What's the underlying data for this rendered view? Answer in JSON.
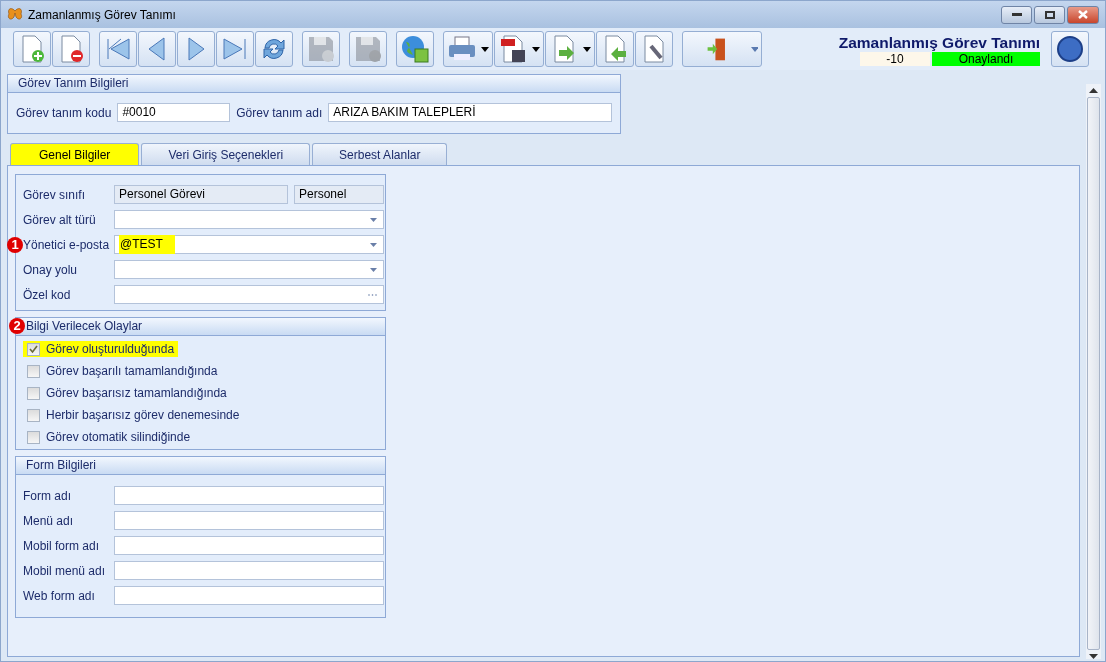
{
  "window": {
    "title": "Zamanlanmış Görev Tanımı"
  },
  "toolbar": [
    [
      {
        "kind": "new",
        "disabled": false,
        "dropdown": false
      },
      {
        "kind": "delete",
        "disabled": false,
        "dropdown": false
      }
    ],
    [
      {
        "kind": "first",
        "disabled": false,
        "dropdown": false
      },
      {
        "kind": "prev",
        "disabled": false,
        "dropdown": false
      },
      {
        "kind": "next",
        "disabled": false,
        "dropdown": false
      },
      {
        "kind": "last",
        "disabled": false,
        "dropdown": false
      },
      {
        "kind": "refresh",
        "disabled": false,
        "dropdown": false
      }
    ],
    [
      {
        "kind": "save",
        "disabled": true,
        "dropdown": false
      }
    ],
    [
      {
        "kind": "cancel",
        "disabled": true,
        "dropdown": false
      }
    ],
    [
      {
        "kind": "publish",
        "disabled": false,
        "dropdown": false
      }
    ],
    [
      {
        "kind": "print",
        "disabled": false,
        "dropdown": true
      },
      {
        "kind": "pdf",
        "disabled": false,
        "dropdown": true
      },
      {
        "kind": "export",
        "disabled": false,
        "dropdown": true
      },
      {
        "kind": "import",
        "disabled": false,
        "dropdown": false
      },
      {
        "kind": "settings",
        "disabled": false,
        "dropdown": false
      }
    ],
    [
      {
        "kind": "exit",
        "disabled": false,
        "dropdown": true
      }
    ]
  ],
  "header": {
    "title": "Zamanlanmış Görev Tanımı",
    "number": "-10",
    "status": "Onaylandı"
  },
  "definition": {
    "title": "Görev Tanım Bilgileri",
    "code_label": "Görev tanım kodu",
    "code": "#0010",
    "name_label": "Görev tanım adı",
    "name": "ARIZA BAKIM TALEPLERİ"
  },
  "tabs": [
    {
      "label": "Genel Bilgiler",
      "selected": true
    },
    {
      "label": "Veri Giriş Seçenekleri",
      "selected": false
    },
    {
      "label": "Serbest Alanlar",
      "selected": false
    }
  ],
  "general": {
    "fields": [
      {
        "label": "Görev sınıfı",
        "kind": "readonly",
        "value": "Personel Görevi",
        "extra": "Personel"
      },
      {
        "label": "Görev alt türü",
        "kind": "combo"
      },
      {
        "label": "Yönetici e-posta",
        "kind": "combo",
        "value": "@TEST",
        "highlighted": true,
        "marker": "1"
      },
      {
        "label": "Onay yolu",
        "kind": "combo"
      },
      {
        "label": "Özel kod",
        "kind": "lookup"
      }
    ]
  },
  "events": {
    "title": "Bilgi Verilecek Olaylar",
    "marker": "2",
    "items": [
      {
        "label": "Görev oluşturulduğunda",
        "checked": true,
        "highlighted": true
      },
      {
        "label": "Görev başarılı tamamlandığında",
        "checked": false,
        "highlighted": false
      },
      {
        "label": "Görev başarısız tamamlandığında",
        "checked": false,
        "highlighted": false
      },
      {
        "label": "Herbir başarısız görev denemesinde",
        "checked": false,
        "highlighted": false
      },
      {
        "label": "Görev otomatik silindiğinde",
        "checked": false,
        "highlighted": false
      }
    ]
  },
  "form": {
    "title": "Form Bilgileri",
    "fields": [
      {
        "label": "Form adı"
      },
      {
        "label": "Menü adı"
      },
      {
        "label": "Mobil form adı"
      },
      {
        "label": "Mobil menü adı"
      },
      {
        "label": "Web form adı"
      }
    ]
  }
}
